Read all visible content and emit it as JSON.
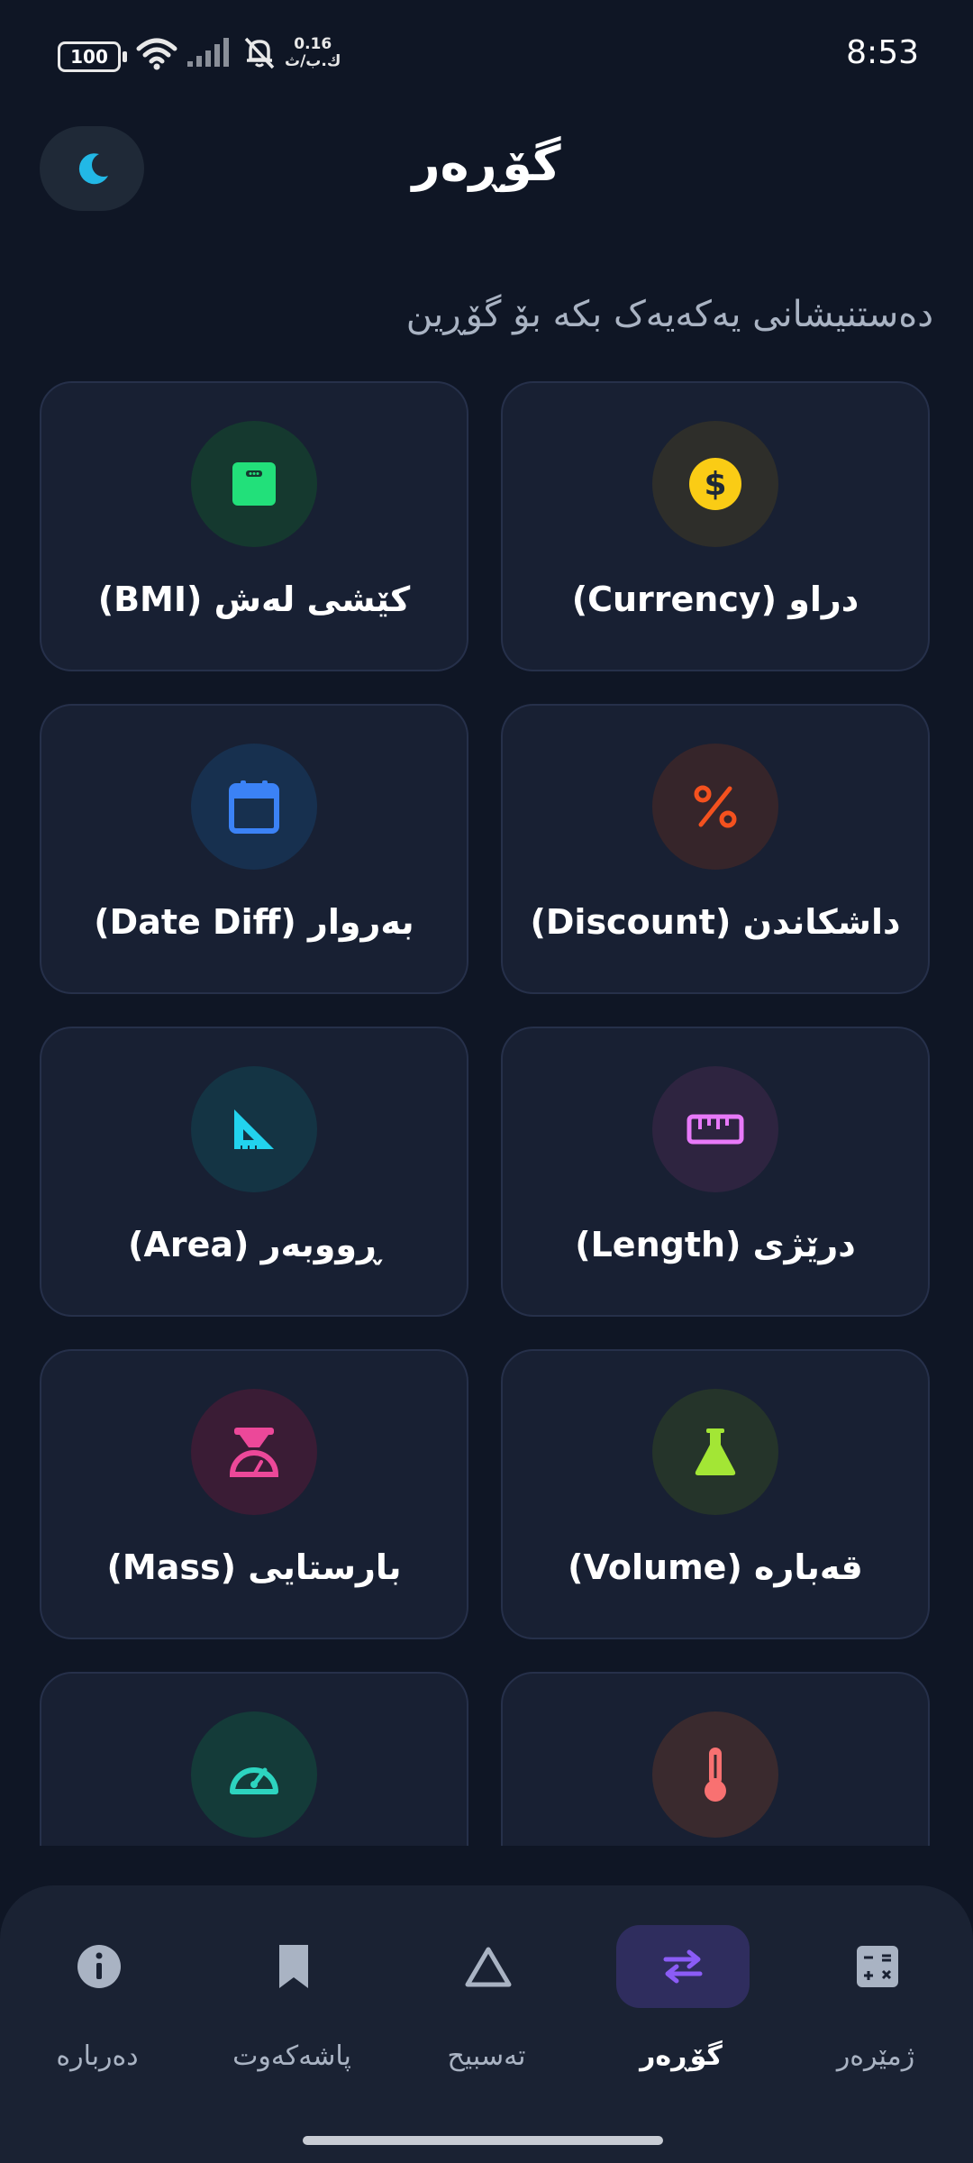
{
  "status_bar": {
    "battery": "100",
    "net_speed": "0.16",
    "net_unit": "ك.ب/ث",
    "time": "8:53"
  },
  "header": {
    "title": "گۆڕەر",
    "subtitle": "دەستنیشانی یەکەیەک بکە بۆ گۆڕین"
  },
  "converters": [
    {
      "label": "دراو (Currency)",
      "icon": "dollar-icon",
      "color": "#facc15"
    },
    {
      "label": "کێشی لەش (BMI)",
      "icon": "scale-icon",
      "color": "#22e07a"
    },
    {
      "label": "داشکاندن (Discount)",
      "icon": "percent-icon",
      "color": "#f4511e"
    },
    {
      "label": "بەروار (Date Diff)",
      "icon": "calendar-icon",
      "color": "#3b82f6"
    },
    {
      "label": "درێژی (Length)",
      "icon": "ruler-icon",
      "color": "#e879f9"
    },
    {
      "label": "ڕووبەر (Area)",
      "icon": "set-square-icon",
      "color": "#22d3ee"
    },
    {
      "label": "قەبارە (Volume)",
      "icon": "flask-icon",
      "color": "#a3e635"
    },
    {
      "label": "بارستایی (Mass)",
      "icon": "weighing-scale-icon",
      "color": "#ec4899"
    },
    {
      "label": "",
      "icon": "thermometer-icon",
      "color": "#f87171"
    },
    {
      "label": "",
      "icon": "speedometer-icon",
      "color": "#2dd4bf"
    }
  ],
  "nav": [
    {
      "label": "دەربارە",
      "icon": "info-icon"
    },
    {
      "label": "پاشەکەوت",
      "icon": "bookmark-icon"
    },
    {
      "label": "تەسبیح",
      "icon": "triangle-icon"
    },
    {
      "label": "گۆڕەر",
      "icon": "swap-icon",
      "active": true
    },
    {
      "label": "ژمێرەر",
      "icon": "calculator-icon"
    }
  ],
  "colors": {
    "background": "#0f1625",
    "card": "#182033",
    "accent": "#8b5cf6",
    "moon": "#22b8e6"
  }
}
